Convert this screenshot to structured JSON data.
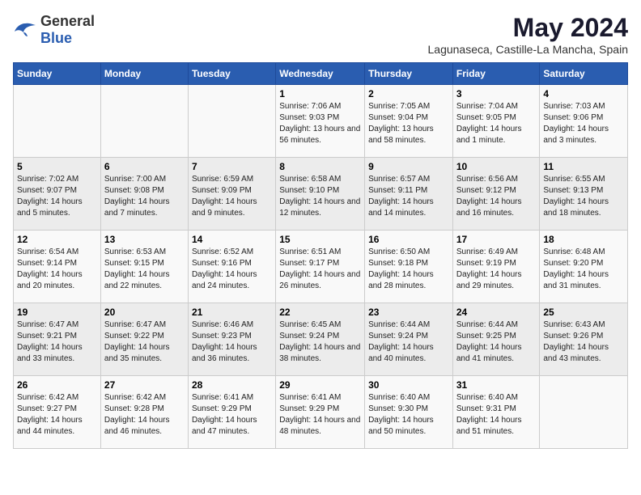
{
  "logo": {
    "general": "General",
    "blue": "Blue"
  },
  "title": "May 2024",
  "subtitle": "Lagunaseca, Castille-La Mancha, Spain",
  "days_of_week": [
    "Sunday",
    "Monday",
    "Tuesday",
    "Wednesday",
    "Thursday",
    "Friday",
    "Saturday"
  ],
  "weeks": [
    [
      {
        "day": "",
        "info": ""
      },
      {
        "day": "",
        "info": ""
      },
      {
        "day": "",
        "info": ""
      },
      {
        "day": "1",
        "info": "Sunrise: 7:06 AM\nSunset: 9:03 PM\nDaylight: 13 hours and 56 minutes."
      },
      {
        "day": "2",
        "info": "Sunrise: 7:05 AM\nSunset: 9:04 PM\nDaylight: 13 hours and 58 minutes."
      },
      {
        "day": "3",
        "info": "Sunrise: 7:04 AM\nSunset: 9:05 PM\nDaylight: 14 hours and 1 minute."
      },
      {
        "day": "4",
        "info": "Sunrise: 7:03 AM\nSunset: 9:06 PM\nDaylight: 14 hours and 3 minutes."
      }
    ],
    [
      {
        "day": "5",
        "info": "Sunrise: 7:02 AM\nSunset: 9:07 PM\nDaylight: 14 hours and 5 minutes."
      },
      {
        "day": "6",
        "info": "Sunrise: 7:00 AM\nSunset: 9:08 PM\nDaylight: 14 hours and 7 minutes."
      },
      {
        "day": "7",
        "info": "Sunrise: 6:59 AM\nSunset: 9:09 PM\nDaylight: 14 hours and 9 minutes."
      },
      {
        "day": "8",
        "info": "Sunrise: 6:58 AM\nSunset: 9:10 PM\nDaylight: 14 hours and 12 minutes."
      },
      {
        "day": "9",
        "info": "Sunrise: 6:57 AM\nSunset: 9:11 PM\nDaylight: 14 hours and 14 minutes."
      },
      {
        "day": "10",
        "info": "Sunrise: 6:56 AM\nSunset: 9:12 PM\nDaylight: 14 hours and 16 minutes."
      },
      {
        "day": "11",
        "info": "Sunrise: 6:55 AM\nSunset: 9:13 PM\nDaylight: 14 hours and 18 minutes."
      }
    ],
    [
      {
        "day": "12",
        "info": "Sunrise: 6:54 AM\nSunset: 9:14 PM\nDaylight: 14 hours and 20 minutes."
      },
      {
        "day": "13",
        "info": "Sunrise: 6:53 AM\nSunset: 9:15 PM\nDaylight: 14 hours and 22 minutes."
      },
      {
        "day": "14",
        "info": "Sunrise: 6:52 AM\nSunset: 9:16 PM\nDaylight: 14 hours and 24 minutes."
      },
      {
        "day": "15",
        "info": "Sunrise: 6:51 AM\nSunset: 9:17 PM\nDaylight: 14 hours and 26 minutes."
      },
      {
        "day": "16",
        "info": "Sunrise: 6:50 AM\nSunset: 9:18 PM\nDaylight: 14 hours and 28 minutes."
      },
      {
        "day": "17",
        "info": "Sunrise: 6:49 AM\nSunset: 9:19 PM\nDaylight: 14 hours and 29 minutes."
      },
      {
        "day": "18",
        "info": "Sunrise: 6:48 AM\nSunset: 9:20 PM\nDaylight: 14 hours and 31 minutes."
      }
    ],
    [
      {
        "day": "19",
        "info": "Sunrise: 6:47 AM\nSunset: 9:21 PM\nDaylight: 14 hours and 33 minutes."
      },
      {
        "day": "20",
        "info": "Sunrise: 6:47 AM\nSunset: 9:22 PM\nDaylight: 14 hours and 35 minutes."
      },
      {
        "day": "21",
        "info": "Sunrise: 6:46 AM\nSunset: 9:23 PM\nDaylight: 14 hours and 36 minutes."
      },
      {
        "day": "22",
        "info": "Sunrise: 6:45 AM\nSunset: 9:24 PM\nDaylight: 14 hours and 38 minutes."
      },
      {
        "day": "23",
        "info": "Sunrise: 6:44 AM\nSunset: 9:24 PM\nDaylight: 14 hours and 40 minutes."
      },
      {
        "day": "24",
        "info": "Sunrise: 6:44 AM\nSunset: 9:25 PM\nDaylight: 14 hours and 41 minutes."
      },
      {
        "day": "25",
        "info": "Sunrise: 6:43 AM\nSunset: 9:26 PM\nDaylight: 14 hours and 43 minutes."
      }
    ],
    [
      {
        "day": "26",
        "info": "Sunrise: 6:42 AM\nSunset: 9:27 PM\nDaylight: 14 hours and 44 minutes."
      },
      {
        "day": "27",
        "info": "Sunrise: 6:42 AM\nSunset: 9:28 PM\nDaylight: 14 hours and 46 minutes."
      },
      {
        "day": "28",
        "info": "Sunrise: 6:41 AM\nSunset: 9:29 PM\nDaylight: 14 hours and 47 minutes."
      },
      {
        "day": "29",
        "info": "Sunrise: 6:41 AM\nSunset: 9:29 PM\nDaylight: 14 hours and 48 minutes."
      },
      {
        "day": "30",
        "info": "Sunrise: 6:40 AM\nSunset: 9:30 PM\nDaylight: 14 hours and 50 minutes."
      },
      {
        "day": "31",
        "info": "Sunrise: 6:40 AM\nSunset: 9:31 PM\nDaylight: 14 hours and 51 minutes."
      },
      {
        "day": "",
        "info": ""
      }
    ]
  ]
}
